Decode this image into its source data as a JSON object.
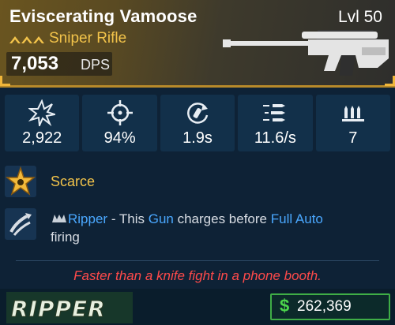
{
  "weapon": {
    "name": "Eviscerating Vamoose",
    "level": "Lvl 50",
    "type": "Sniper Rifle",
    "dps_value": "7,053",
    "dps_label": "DPS",
    "rarity_color": "#f2c34a",
    "gun_icon": "sniper-rifle-icon"
  },
  "stats": [
    {
      "icon": "damage-icon",
      "value": "2,922"
    },
    {
      "icon": "accuracy-crosshair-icon",
      "value": "94%"
    },
    {
      "icon": "reload-icon",
      "value": "1.9s"
    },
    {
      "icon": "fire-rate-icon",
      "value": "11.6/s"
    },
    {
      "icon": "magazine-icon",
      "value": "7"
    }
  ],
  "rarity": {
    "icon": "scarce-star-icon",
    "label": "Scarce"
  },
  "ability": {
    "icon": "ripper-bullets-icon",
    "tag_icon": "ripper-logo-icon",
    "name": "Ripper",
    "sep": " - This ",
    "word1": "Gun",
    "mid": " charges before ",
    "word2": "Full Auto",
    "end": "firing"
  },
  "flavor": "Faster than a knife fight in a phone booth.",
  "manufacturer": {
    "logo": "ripper-manufacturer-logo",
    "text": "Ripper"
  },
  "price": {
    "icon": "$",
    "value": "262,369",
    "accent": "#3fae46"
  },
  "colors": {
    "accent_yellow": "#f2c34a",
    "accent_blue": "#4aa8ff",
    "flavor_red": "#ff4a4a",
    "panel": "#12304a"
  }
}
